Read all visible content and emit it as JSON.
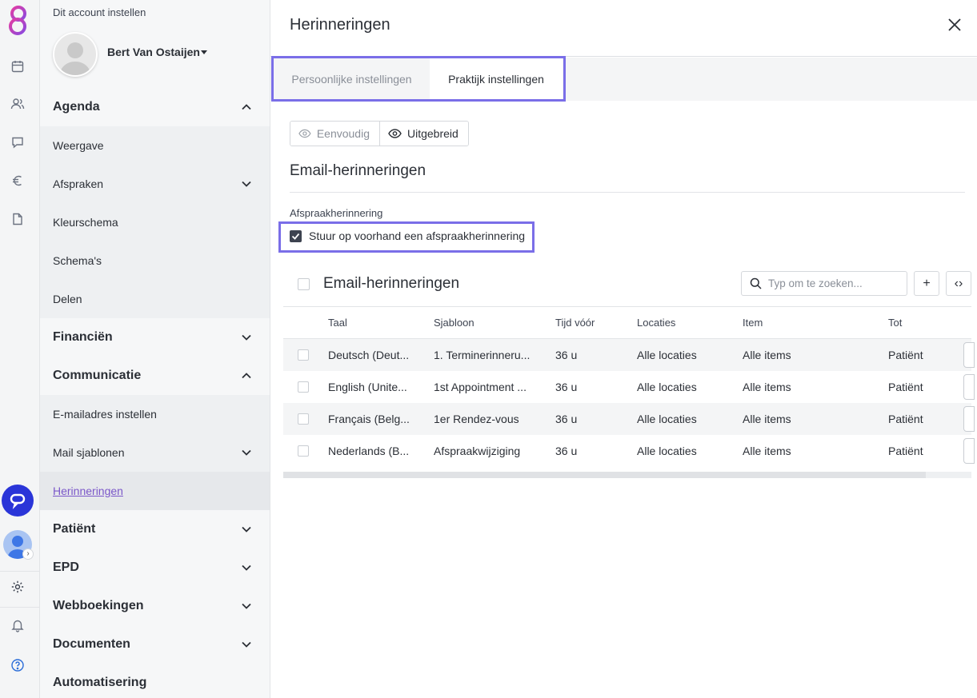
{
  "account": {
    "setup_label": "Dit account instellen",
    "user_name": "Bert Van Ostaijen"
  },
  "menu": {
    "agenda": "Agenda",
    "weergave": "Weergave",
    "afspraken": "Afspraken",
    "kleurschema": "Kleurschema",
    "schemas": "Schema's",
    "delen": "Delen",
    "financien": "Financiën",
    "communicatie": "Communicatie",
    "emailadres": "E-mailadres instellen",
    "mail_sjablonen": "Mail sjablonen",
    "herinneringen": "Herinneringen",
    "patient": "Patiënt",
    "epd": "EPD",
    "webboekingen": "Webboekingen",
    "documenten": "Documenten",
    "automatisering": "Automatisering"
  },
  "panel": {
    "title": "Herinneringen",
    "tabs": [
      "Persoonlijke instellingen",
      "Praktijk instellingen"
    ],
    "view_modes": [
      "Eenvoudig",
      "Uitgebreid"
    ],
    "section_title": "Email-herinneringen",
    "field_label": "Afspraakherinnering",
    "checkbox_label": "Stuur op voorhand een afspraakherinnering",
    "checkbox_checked": true
  },
  "table": {
    "title": "Email-herinneringen",
    "search_placeholder": "Typ om te zoeken...",
    "add_label": "+",
    "code_label": "‹›",
    "columns": [
      "Taal",
      "Sjabloon",
      "Tijd vóór",
      "Locaties",
      "Item",
      "Tot"
    ],
    "rows": [
      {
        "taal": "Deutsch (Deut...",
        "sjabloon": "1. Terminerinneru...",
        "tijd": "36 u",
        "locaties": "Alle locaties",
        "item": "Alle items",
        "tot": "Patiënt"
      },
      {
        "taal": "English (Unite...",
        "sjabloon": "1st Appointment ...",
        "tijd": "36 u",
        "locaties": "Alle locaties",
        "item": "Alle items",
        "tot": "Patiënt"
      },
      {
        "taal": "Français (Belg...",
        "sjabloon": "1er Rendez-vous",
        "tijd": "36 u",
        "locaties": "Alle locaties",
        "item": "Alle items",
        "tot": "Patiënt"
      },
      {
        "taal": "Nederlands (B...",
        "sjabloon": "Afspraakwijziging",
        "tijd": "36 u",
        "locaties": "Alle locaties",
        "item": "Alle items",
        "tot": "Patiënt"
      }
    ]
  },
  "colors": {
    "highlight": "#7a6ee8",
    "link_active": "#7b57c9",
    "chat_button": "#2a35d8"
  }
}
